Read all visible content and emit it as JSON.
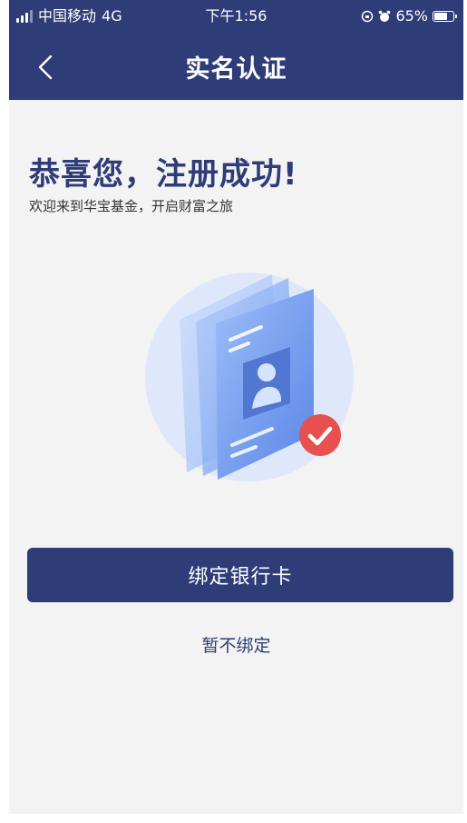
{
  "status_bar": {
    "carrier": "中国移动",
    "network": "4G",
    "time": "下午1:56",
    "battery": "65%",
    "battery_level": 0.65
  },
  "nav": {
    "title": "实名认证",
    "back_icon": "chevron-left-icon"
  },
  "content": {
    "headline": "恭喜您，注册成功!",
    "subline": "欢迎来到华宝基金，开启财富之旅",
    "illustration": "id-card-verified-illustration"
  },
  "actions": {
    "primary_label": "绑定银行卡",
    "secondary_label": "暂不绑定"
  },
  "colors": {
    "brand": "#2e3c78",
    "background": "#f3f3f3",
    "check_badge": "#e8504f"
  }
}
